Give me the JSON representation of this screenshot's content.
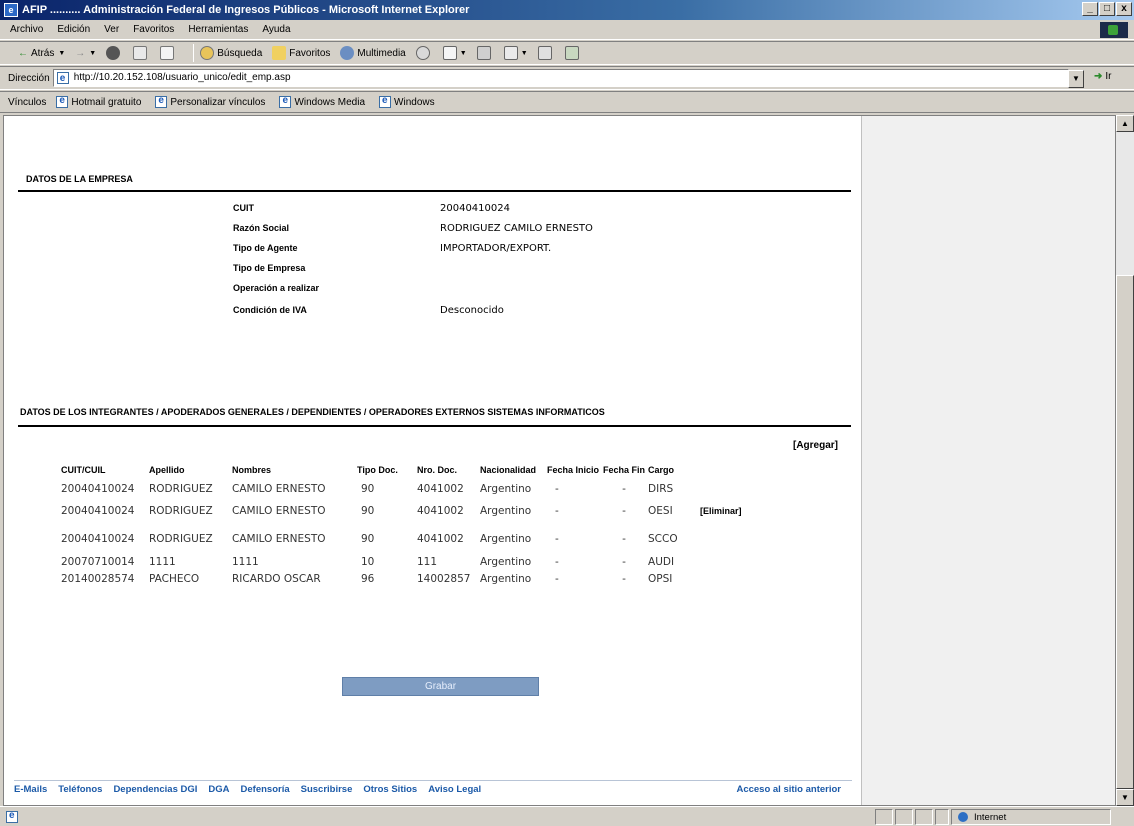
{
  "window": {
    "title": "AFIP .......... Administración Federal de Ingresos Públicos - Microsoft Internet Explorer",
    "app_icon": "ie-icon",
    "controls": [
      "_",
      "□",
      "x"
    ]
  },
  "menu": [
    "Archivo",
    "Edición",
    "Ver",
    "Favoritos",
    "Herramientas",
    "Ayuda"
  ],
  "toolbar": {
    "back_label": "Atrás",
    "search_label": "Búsqueda",
    "favorites_label": "Favoritos",
    "multimedia_label": "Multimedia"
  },
  "address": {
    "label": "Dirección",
    "url": "http://10.20.152.108/usuario_unico/edit_emp.asp",
    "go_label": "Ir"
  },
  "links": {
    "label": "Vínculos",
    "items": [
      "Hotmail gratuito",
      "Personalizar vínculos",
      "Windows Media",
      "Windows"
    ]
  },
  "empresa": {
    "section_title": "DATOS DE LA EMPRESA",
    "rows": [
      {
        "key": "CUIT",
        "value": "20040410024"
      },
      {
        "key": "Razón Social",
        "value": "RODRIGUEZ CAMILO ERNESTO"
      },
      {
        "key": "Tipo de Agente",
        "value": "IMPORTADOR/EXPORT."
      },
      {
        "key": "Tipo de Empresa",
        "value": ""
      },
      {
        "key": "Operación a realizar",
        "value": ""
      },
      {
        "key": "Condición de IVA",
        "value": "Desconocido"
      }
    ]
  },
  "integrantes": {
    "section_title": "DATOS DE LOS INTEGRANTES / APODERADOS GENERALES / DEPENDIENTES / OPERADORES EXTERNOS SISTEMAS INFORMATICOS",
    "add_link": "[Agregar]",
    "columns": [
      "CUIT/CUIL",
      "Apellido",
      "Nombres",
      "Tipo Doc.",
      "Nro. Doc.",
      "Nacionalidad",
      "Fecha Inicio",
      "Fecha Fin",
      "Cargo"
    ],
    "rows": [
      {
        "cuit": "20040410024",
        "apellido": "RODRIGUEZ",
        "nombres": "CAMILO ERNESTO",
        "tipo": "90",
        "nro": "4041002",
        "nac": "Argentino",
        "inicio": "-",
        "fin": "-",
        "cargo": "DIRS",
        "action": ""
      },
      {
        "cuit": "20040410024",
        "apellido": "RODRIGUEZ",
        "nombres": "CAMILO ERNESTO",
        "tipo": "90",
        "nro": "4041002",
        "nac": "Argentino",
        "inicio": "-",
        "fin": "-",
        "cargo": "OESI",
        "action": "[Eliminar]"
      },
      {
        "cuit": "20040410024",
        "apellido": "RODRIGUEZ",
        "nombres": "CAMILO ERNESTO",
        "tipo": "90",
        "nro": "4041002",
        "nac": "Argentino",
        "inicio": "-",
        "fin": "-",
        "cargo": "SCCO",
        "action": ""
      },
      {
        "cuit": "20070710014",
        "apellido": "1111",
        "nombres": "1111",
        "tipo": "10",
        "nro": "111",
        "nac": "Argentino",
        "inicio": "-",
        "fin": "-",
        "cargo": "AUDI",
        "action": ""
      },
      {
        "cuit": "20140028574",
        "apellido": "PACHECO",
        "nombres": "RICARDO OSCAR",
        "tipo": "96",
        "nro": "14002857",
        "nac": "Argentino",
        "inicio": "-",
        "fin": "-",
        "cargo": "OPSI",
        "action": ""
      }
    ]
  },
  "grabar_label": "Grabar",
  "footer": {
    "links": [
      "E-Mails",
      "Teléfonos",
      "Dependencias DGI",
      "DGA",
      "Defensoría",
      "Suscribirse",
      "Otros Sitios",
      "Aviso Legal"
    ],
    "back_link": "Acceso al sitio anterior"
  },
  "status": {
    "zone": "Internet"
  },
  "colors": {
    "title_start": "#0a246a",
    "chrome": "#d4d0c8",
    "footer_link": "#1c5aa8",
    "button": "#7e9cc2"
  }
}
